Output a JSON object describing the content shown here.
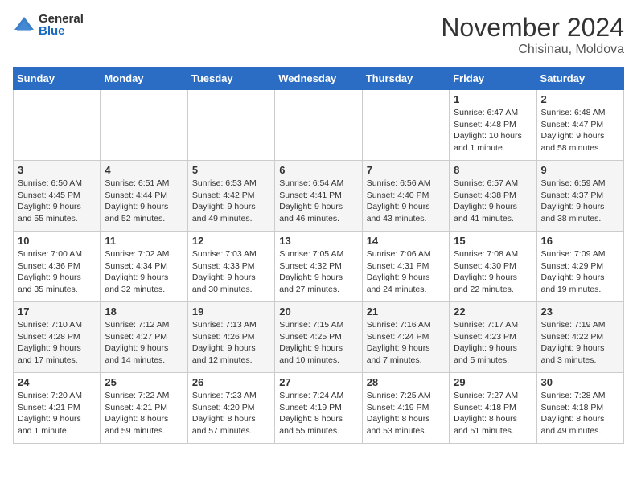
{
  "logo": {
    "general": "General",
    "blue": "Blue"
  },
  "title": "November 2024",
  "location": "Chisinau, Moldova",
  "header_days": [
    "Sunday",
    "Monday",
    "Tuesday",
    "Wednesday",
    "Thursday",
    "Friday",
    "Saturday"
  ],
  "weeks": [
    [
      {
        "day": "",
        "info": ""
      },
      {
        "day": "",
        "info": ""
      },
      {
        "day": "",
        "info": ""
      },
      {
        "day": "",
        "info": ""
      },
      {
        "day": "",
        "info": ""
      },
      {
        "day": "1",
        "info": "Sunrise: 6:47 AM\nSunset: 4:48 PM\nDaylight: 10 hours\nand 1 minute."
      },
      {
        "day": "2",
        "info": "Sunrise: 6:48 AM\nSunset: 4:47 PM\nDaylight: 9 hours\nand 58 minutes."
      }
    ],
    [
      {
        "day": "3",
        "info": "Sunrise: 6:50 AM\nSunset: 4:45 PM\nDaylight: 9 hours\nand 55 minutes."
      },
      {
        "day": "4",
        "info": "Sunrise: 6:51 AM\nSunset: 4:44 PM\nDaylight: 9 hours\nand 52 minutes."
      },
      {
        "day": "5",
        "info": "Sunrise: 6:53 AM\nSunset: 4:42 PM\nDaylight: 9 hours\nand 49 minutes."
      },
      {
        "day": "6",
        "info": "Sunrise: 6:54 AM\nSunset: 4:41 PM\nDaylight: 9 hours\nand 46 minutes."
      },
      {
        "day": "7",
        "info": "Sunrise: 6:56 AM\nSunset: 4:40 PM\nDaylight: 9 hours\nand 43 minutes."
      },
      {
        "day": "8",
        "info": "Sunrise: 6:57 AM\nSunset: 4:38 PM\nDaylight: 9 hours\nand 41 minutes."
      },
      {
        "day": "9",
        "info": "Sunrise: 6:59 AM\nSunset: 4:37 PM\nDaylight: 9 hours\nand 38 minutes."
      }
    ],
    [
      {
        "day": "10",
        "info": "Sunrise: 7:00 AM\nSunset: 4:36 PM\nDaylight: 9 hours\nand 35 minutes."
      },
      {
        "day": "11",
        "info": "Sunrise: 7:02 AM\nSunset: 4:34 PM\nDaylight: 9 hours\nand 32 minutes."
      },
      {
        "day": "12",
        "info": "Sunrise: 7:03 AM\nSunset: 4:33 PM\nDaylight: 9 hours\nand 30 minutes."
      },
      {
        "day": "13",
        "info": "Sunrise: 7:05 AM\nSunset: 4:32 PM\nDaylight: 9 hours\nand 27 minutes."
      },
      {
        "day": "14",
        "info": "Sunrise: 7:06 AM\nSunset: 4:31 PM\nDaylight: 9 hours\nand 24 minutes."
      },
      {
        "day": "15",
        "info": "Sunrise: 7:08 AM\nSunset: 4:30 PM\nDaylight: 9 hours\nand 22 minutes."
      },
      {
        "day": "16",
        "info": "Sunrise: 7:09 AM\nSunset: 4:29 PM\nDaylight: 9 hours\nand 19 minutes."
      }
    ],
    [
      {
        "day": "17",
        "info": "Sunrise: 7:10 AM\nSunset: 4:28 PM\nDaylight: 9 hours\nand 17 minutes."
      },
      {
        "day": "18",
        "info": "Sunrise: 7:12 AM\nSunset: 4:27 PM\nDaylight: 9 hours\nand 14 minutes."
      },
      {
        "day": "19",
        "info": "Sunrise: 7:13 AM\nSunset: 4:26 PM\nDaylight: 9 hours\nand 12 minutes."
      },
      {
        "day": "20",
        "info": "Sunrise: 7:15 AM\nSunset: 4:25 PM\nDaylight: 9 hours\nand 10 minutes."
      },
      {
        "day": "21",
        "info": "Sunrise: 7:16 AM\nSunset: 4:24 PM\nDaylight: 9 hours\nand 7 minutes."
      },
      {
        "day": "22",
        "info": "Sunrise: 7:17 AM\nSunset: 4:23 PM\nDaylight: 9 hours\nand 5 minutes."
      },
      {
        "day": "23",
        "info": "Sunrise: 7:19 AM\nSunset: 4:22 PM\nDaylight: 9 hours\nand 3 minutes."
      }
    ],
    [
      {
        "day": "24",
        "info": "Sunrise: 7:20 AM\nSunset: 4:21 PM\nDaylight: 9 hours\nand 1 minute."
      },
      {
        "day": "25",
        "info": "Sunrise: 7:22 AM\nSunset: 4:21 PM\nDaylight: 8 hours\nand 59 minutes."
      },
      {
        "day": "26",
        "info": "Sunrise: 7:23 AM\nSunset: 4:20 PM\nDaylight: 8 hours\nand 57 minutes."
      },
      {
        "day": "27",
        "info": "Sunrise: 7:24 AM\nSunset: 4:19 PM\nDaylight: 8 hours\nand 55 minutes."
      },
      {
        "day": "28",
        "info": "Sunrise: 7:25 AM\nSunset: 4:19 PM\nDaylight: 8 hours\nand 53 minutes."
      },
      {
        "day": "29",
        "info": "Sunrise: 7:27 AM\nSunset: 4:18 PM\nDaylight: 8 hours\nand 51 minutes."
      },
      {
        "day": "30",
        "info": "Sunrise: 7:28 AM\nSunset: 4:18 PM\nDaylight: 8 hours\nand 49 minutes."
      }
    ]
  ]
}
